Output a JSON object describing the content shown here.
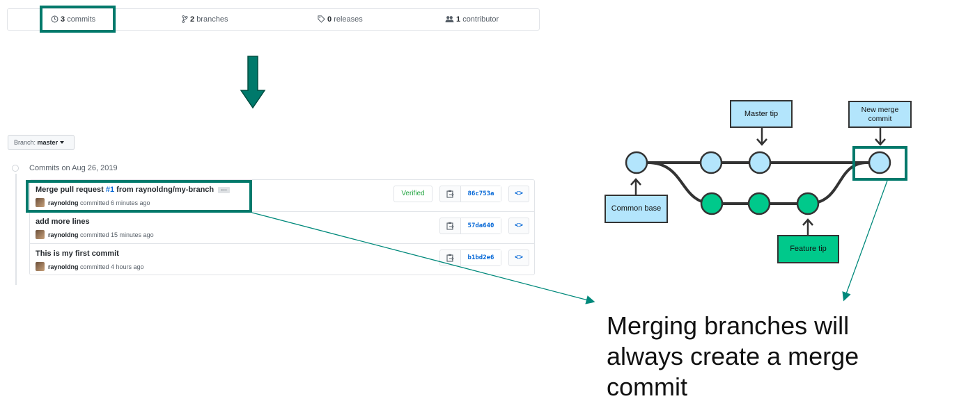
{
  "summary": {
    "commits": {
      "count": "3",
      "label": "commits"
    },
    "branches": {
      "count": "2",
      "label": "branches"
    },
    "releases": {
      "count": "0",
      "label": "releases"
    },
    "contributors": {
      "count": "1",
      "label": "contributor"
    }
  },
  "branch_select": {
    "prefix": "Branch:",
    "value": "master"
  },
  "commit_group": {
    "date_header": "Commits on Aug 26, 2019",
    "commits": [
      {
        "title_prefix": "Merge pull request ",
        "issue": "#1",
        "title_suffix": " from raynoldng/my-branch",
        "author": "raynoldng",
        "meta": " committed 6 minutes ago",
        "verified": "Verified",
        "sha": "86c753a",
        "has_ellipsis": true,
        "ellipsis": "…"
      },
      {
        "title_prefix": "add more lines",
        "author": "raynoldng",
        "meta": " committed 15 minutes ago",
        "sha": "57da640"
      },
      {
        "title_prefix": "This is my first commit",
        "author": "raynoldng",
        "meta": " committed 4 hours ago",
        "sha": "b1bd2e6"
      }
    ],
    "browse_glyph": "<>"
  },
  "diagram": {
    "labels": {
      "master_tip": "Master tip",
      "new_merge_commit": "New merge commit",
      "common_base": "Common base",
      "feature_tip": "Feature tip"
    },
    "colors": {
      "master_node": "#b3e5fc",
      "feature_node": "#00c98b",
      "highlight": "#00796b",
      "line": "#333333"
    }
  },
  "caption": "Merging branches will always create a merge commit"
}
